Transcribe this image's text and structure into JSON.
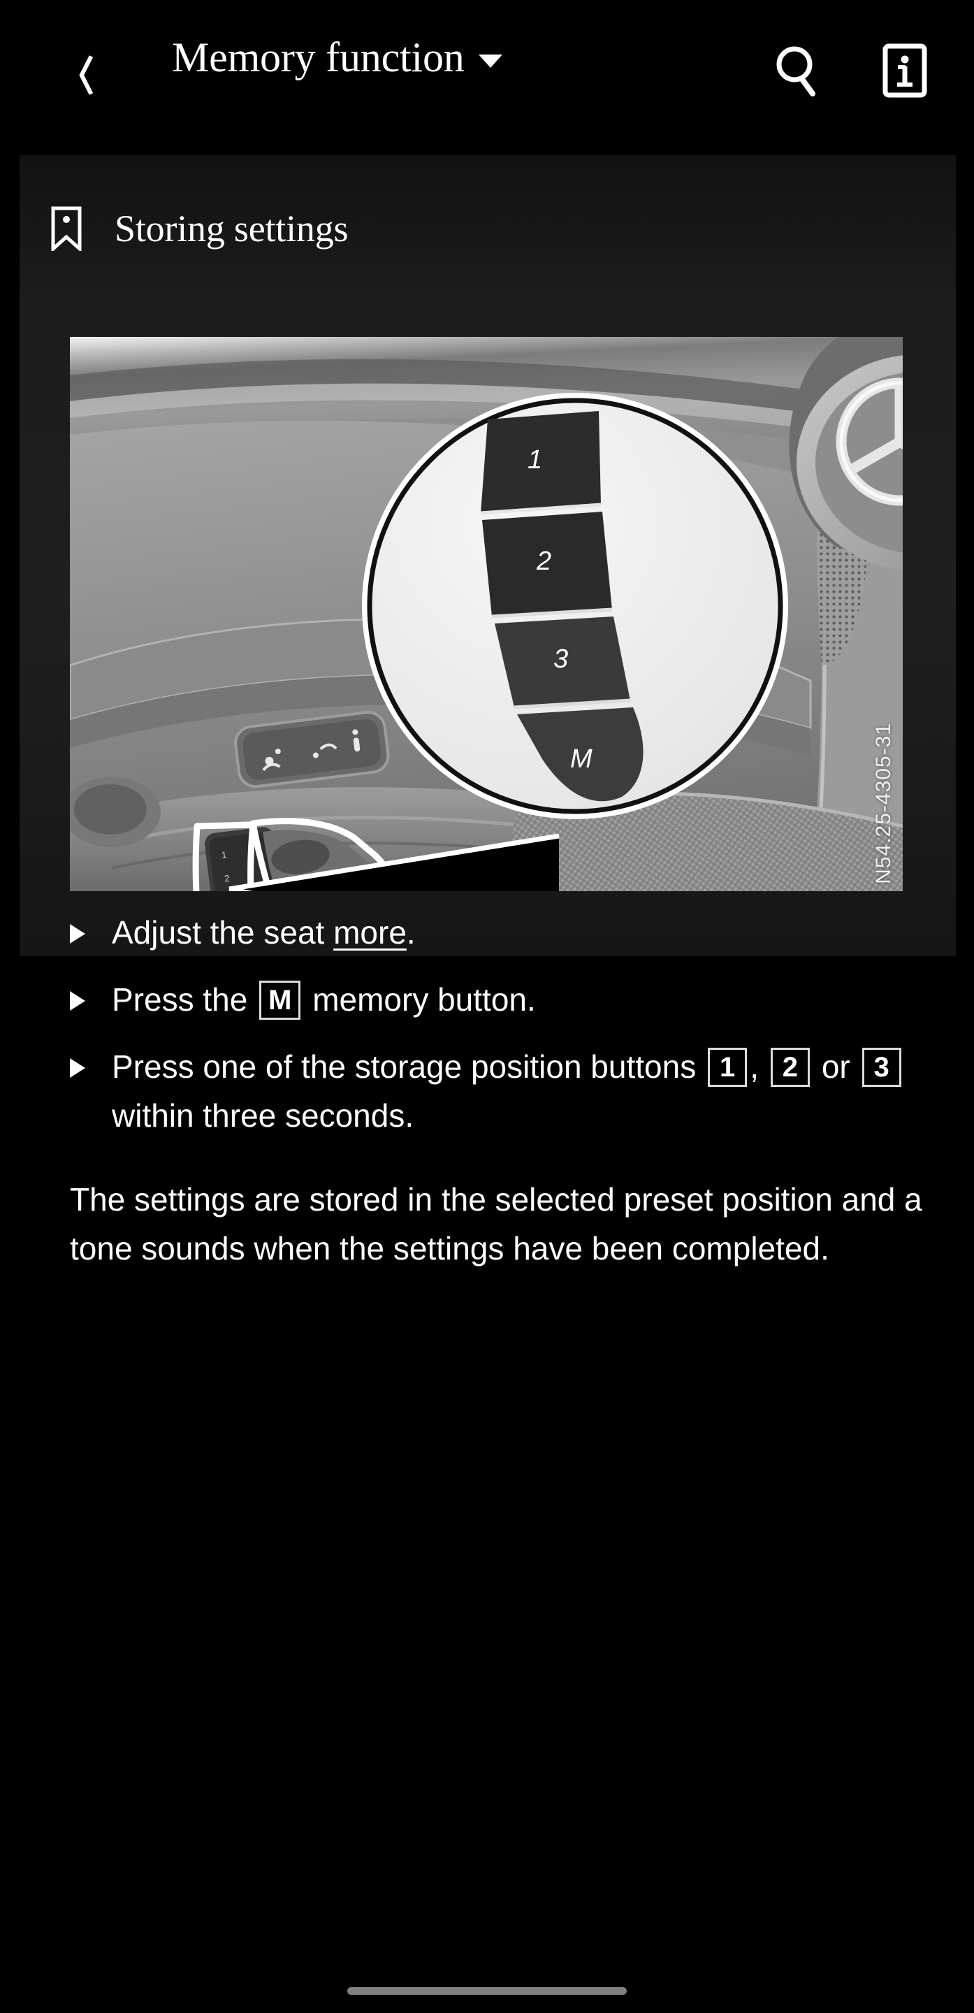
{
  "appbar": {
    "back_icon": "chevron-left-icon",
    "title": "Memory function",
    "dropdown_icon": "chevron-down-icon",
    "search_icon": "search-icon",
    "info_icon": "info-icon"
  },
  "section": {
    "bookmark_icon": "bookmark-icon",
    "heading": "Storing settings"
  },
  "figure": {
    "code": "N54.25-4305-31",
    "alt": "Mercedes-Benz driver door panel with seat memory buttons, magnified callout",
    "callout_buttons": [
      "1",
      "2",
      "3",
      "M"
    ],
    "colors": {
      "photo_base": "#8d8d8d",
      "callout_fill": "#ededed",
      "button_dark": "#2a2a2a"
    }
  },
  "steps": [
    {
      "bullet": "triangle-bullet",
      "prefix": "Adjust the seat ",
      "link": "more",
      "suffix": "."
    },
    {
      "bullet": "triangle-bullet",
      "prefix": "Press the ",
      "badge": "M",
      "suffix": " memory button."
    },
    {
      "bullet": "triangle-bullet",
      "prefix": "Press one of the storage position buttons ",
      "badge1": "1",
      "sep1": ", ",
      "badge2": "2",
      "sep2": " or ",
      "badge3": "3",
      "suffix": " within three seconds."
    }
  ],
  "paragraph": "The settings are stored in the selected preset position and a tone sounds when the settings have been completed.",
  "system": {
    "home_indicator": "home-indicator"
  },
  "theme": {
    "background": "#000000",
    "panel": "#1c1c1c",
    "text": "#ffffff",
    "indicator": "#808080"
  }
}
